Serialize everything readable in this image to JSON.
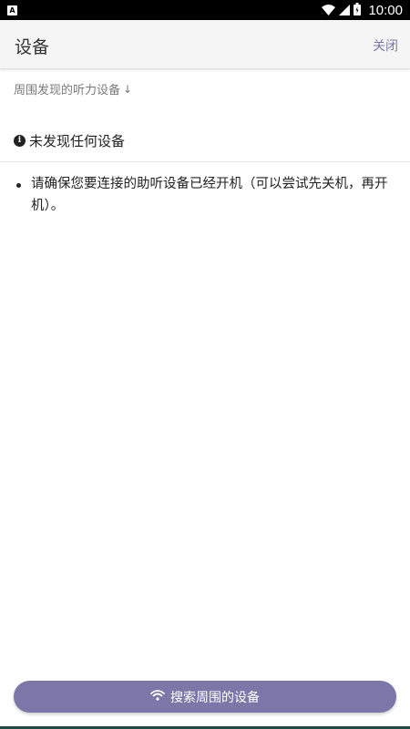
{
  "status_bar": {
    "notification_badge": "A",
    "time": "10:00"
  },
  "app_bar": {
    "title": "设备",
    "close_label": "关闭"
  },
  "nearby_section": {
    "label": "周围发现的听力设备",
    "arrow": "↓"
  },
  "empty_state": {
    "message": "未发现任何设备"
  },
  "tips": [
    "请确保您要连接的助听设备已经开机（可以尝试先关机，再开机）。"
  ],
  "search_button": {
    "label": "搜索周围的设备"
  },
  "colors": {
    "accent": "#7b77a8",
    "status_bar": "#000000",
    "app_bar_bg": "#f5f5f5"
  },
  "icons": [
    "wifi-icon",
    "signal-icon",
    "battery-icon",
    "info-icon",
    "arrow-down-icon"
  ]
}
